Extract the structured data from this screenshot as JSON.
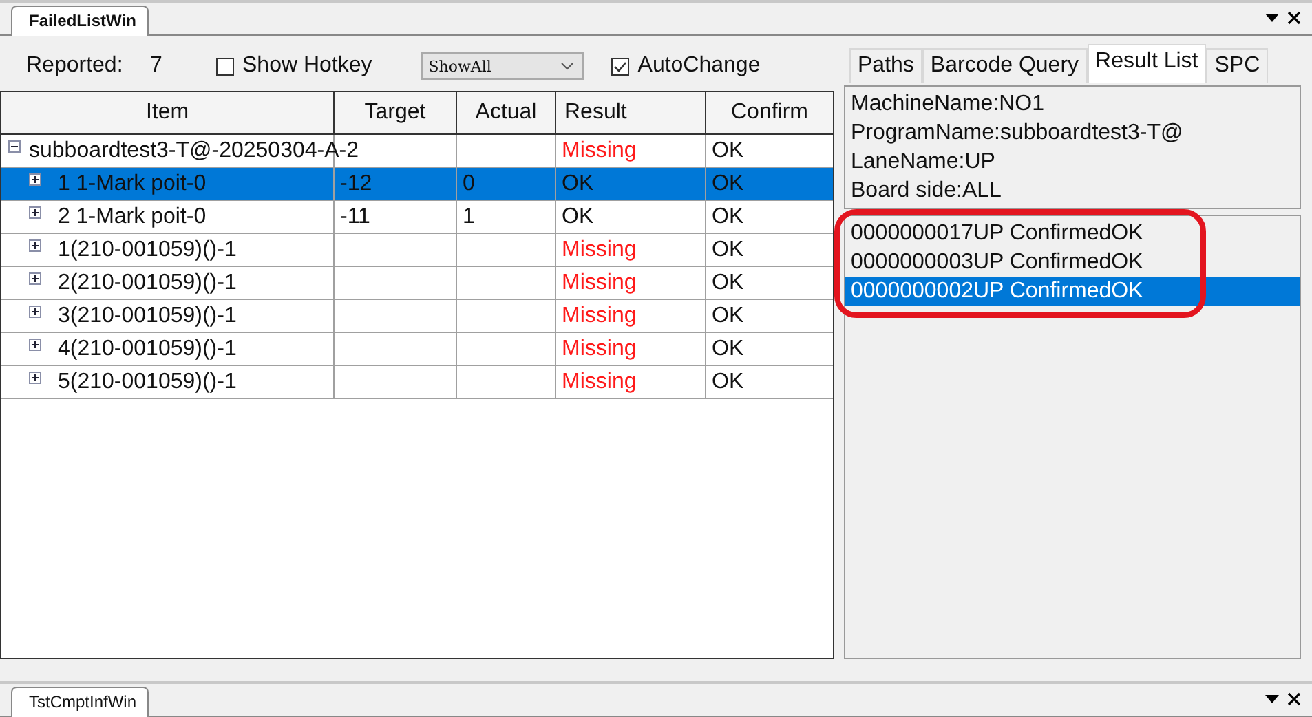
{
  "top_tab": {
    "label": "FailedListWin",
    "selected": true
  },
  "toolbar": {
    "reported_label": "Reported:",
    "reported_value": "7",
    "show_hotkey": {
      "label": "Show Hotkey",
      "checked": false
    },
    "filter": {
      "value": "ShowAll"
    },
    "auto_change": {
      "label": "AutoChange",
      "checked": true
    }
  },
  "table": {
    "columns": [
      "Item",
      "Target",
      "Actual",
      "Result",
      "Confirm"
    ],
    "rows": [
      {
        "item": "subboardtest3-T@-20250304-A-2",
        "result": "Missing",
        "missing": true,
        "confirm": "OK",
        "selected": false,
        "expanded": true,
        "children": [
          {
            "item": "1  1-Mark poit-0",
            "target": "-12",
            "actual": "0",
            "result": "OK",
            "missing": false,
            "confirm": "OK",
            "selected": true,
            "expanded": false
          },
          {
            "item": "2  1-Mark poit-0",
            "target": "-11",
            "actual": "1",
            "result": "OK",
            "missing": false,
            "confirm": "OK",
            "selected": false,
            "expanded": false
          },
          {
            "item": "1(210-001059)()-1",
            "result": "Missing",
            "missing": true,
            "confirm": "OK",
            "selected": false,
            "expanded": false
          },
          {
            "item": "2(210-001059)()-1",
            "result": "Missing",
            "missing": true,
            "confirm": "OK",
            "selected": false,
            "expanded": false
          },
          {
            "item": "3(210-001059)()-1",
            "result": "Missing",
            "missing": true,
            "confirm": "OK",
            "selected": false,
            "expanded": false
          },
          {
            "item": "4(210-001059)()-1",
            "result": "Missing",
            "missing": true,
            "confirm": "OK",
            "selected": false,
            "expanded": false
          },
          {
            "item": "5(210-001059)()-1",
            "result": "Missing",
            "missing": true,
            "confirm": "OK",
            "selected": false,
            "expanded": false
          }
        ]
      }
    ]
  },
  "side_tabs": [
    {
      "label": "Paths",
      "selected": false
    },
    {
      "label": "Barcode Query",
      "selected": false
    },
    {
      "label": "Result List",
      "selected": true
    },
    {
      "label": "SPC",
      "selected": false
    }
  ],
  "info": [
    "MachineName:NO1",
    "ProgramName:subboardtest3-T@",
    "LaneName:UP",
    "Board side:ALL"
  ],
  "results": [
    {
      "text": "0000000017UP ConfirmedOK",
      "selected": false,
      "circled": true
    },
    {
      "text": "0000000003UP ConfirmedOK",
      "selected": false,
      "circled": true
    },
    {
      "text": "0000000002UP ConfirmedOK",
      "selected": true,
      "circled": true
    }
  ],
  "bottom_tab": {
    "label": "TstCmptInfWin",
    "selected": true
  }
}
